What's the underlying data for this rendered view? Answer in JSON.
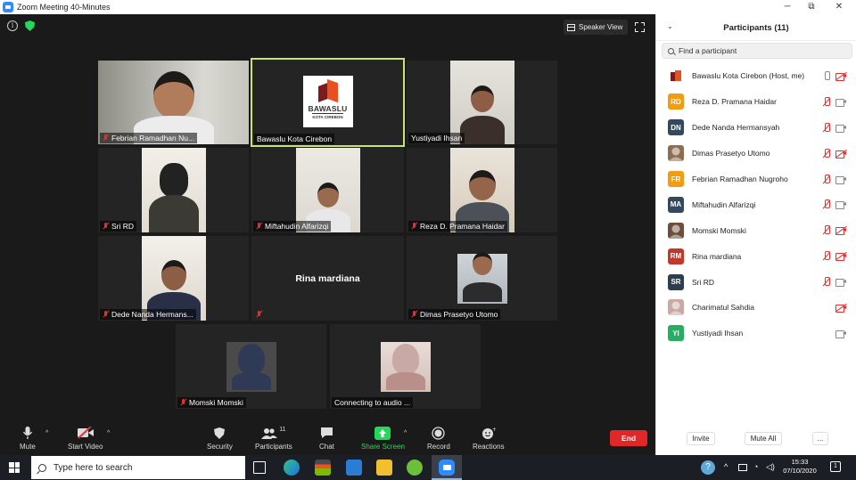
{
  "window": {
    "title": "Zoom Meeting 40-Minutes",
    "minimize": "─",
    "maximize": "⧉",
    "close": "✕"
  },
  "meeting": {
    "speaker_view_label": "Speaker View",
    "tiles": {
      "febrian": "Febrian Ramadhan Nu...",
      "bawaslu": "Bawaslu Kota Cirebon",
      "yustiyadi": "Yustiyadi Ihsan",
      "sri": "Sri RD",
      "miftahudin": "Miftahudin Alfarizqi",
      "reza": "Reza D. Pramana Haidar",
      "dede": "Dede Nanda Hermans...",
      "rina_center": "Rina mardiana",
      "dimas": "Dimas Prasetyo Utomo",
      "momski": "Momski Momski",
      "connecting": "Connecting to audio ..."
    },
    "logo": {
      "word": "BAWASLU",
      "sub": "KOTA CIREBON"
    }
  },
  "toolbar": {
    "mute": "Mute",
    "start_video": "Start Video",
    "security": "Security",
    "participants": "Participants",
    "participants_count": "11",
    "chat": "Chat",
    "share_screen": "Share Screen",
    "record": "Record",
    "reactions": "Reactions",
    "end": "End"
  },
  "panel": {
    "title": "Participants (11)",
    "search_placeholder": "Find a participant",
    "participants": [
      {
        "name": "Bawaslu Kota Cirebon (Host, me)",
        "initials": "",
        "color": "#ffffff",
        "mic_muted": false,
        "cam_off": true
      },
      {
        "name": "Reza D. Pramana Haidar",
        "initials": "RD",
        "color": "#f39c12",
        "mic_muted": true,
        "cam_off": false
      },
      {
        "name": "Dede Nanda Hermansyah",
        "initials": "DN",
        "color": "#34495e",
        "mic_muted": true,
        "cam_off": false
      },
      {
        "name": "Dimas Prasetyo Utomo",
        "initials": "",
        "color": "#8e6e53",
        "mic_muted": true,
        "cam_off": true
      },
      {
        "name": "Febrian Ramadhan Nugroho",
        "initials": "FR",
        "color": "#f39c12",
        "mic_muted": true,
        "cam_off": false
      },
      {
        "name": "Miftahudin Alfarizqi",
        "initials": "MA",
        "color": "#34495e",
        "mic_muted": true,
        "cam_off": false
      },
      {
        "name": "Momski Momski",
        "initials": "",
        "color": "#6b4f3a",
        "mic_muted": true,
        "cam_off": true
      },
      {
        "name": "Rina mardiana",
        "initials": "RM",
        "color": "#c0392b",
        "mic_muted": true,
        "cam_off": true
      },
      {
        "name": "Sri RD",
        "initials": "SR",
        "color": "#2c3e50",
        "mic_muted": true,
        "cam_off": false
      },
      {
        "name": "Charimatul Sahdia",
        "initials": "",
        "color": "#c9a9a6",
        "mic_muted": null,
        "cam_off": true
      },
      {
        "name": "Yustiyadi Ihsan",
        "initials": "YI",
        "color": "#27ae60",
        "mic_muted": null,
        "cam_off": false
      }
    ],
    "invite": "Invite",
    "mute_all": "Mute All",
    "more": "..."
  },
  "taskbar": {
    "search_placeholder": "Type here to search",
    "time": "15:33",
    "date": "07/10/2020",
    "notification_count": "1"
  }
}
